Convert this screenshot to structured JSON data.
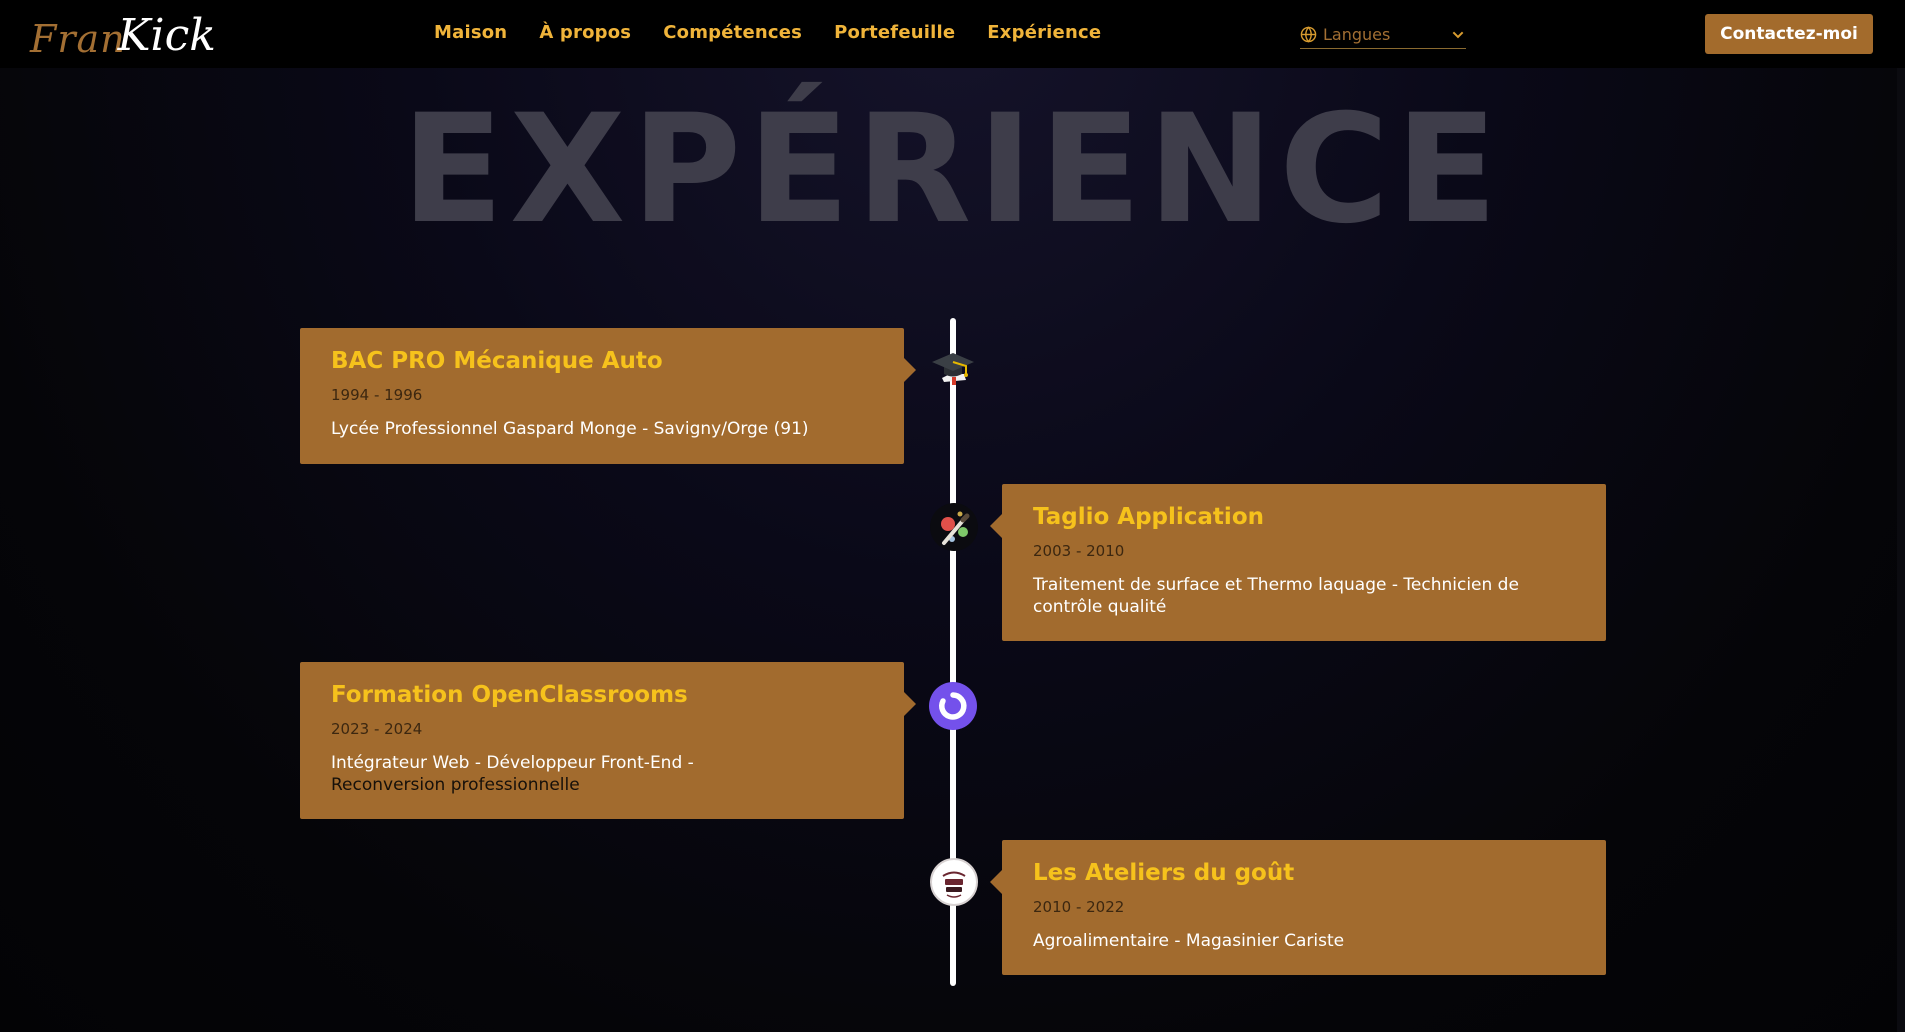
{
  "navbar": {
    "logo": {
      "part1": "Fran",
      "part2": "Kick"
    },
    "links": [
      "Maison",
      "À propos",
      "Compétences",
      "Portefeuille",
      "Expérience"
    ],
    "language": {
      "label": "Langues",
      "icon": "globe-icon"
    },
    "contact_label": "Contactez-moi"
  },
  "section": {
    "title": "EXPÉRIENCE"
  },
  "timeline": [
    {
      "side": "left",
      "icon": "graduation-cap-icon",
      "title": "BAC PRO Mécanique Auto",
      "date": "1994 - 1996",
      "description": "Lycée Professionnel Gaspard Monge - Savigny/Orge (91)"
    },
    {
      "side": "right",
      "icon": "paint-spray-icon",
      "title": "Taglio Application",
      "date": "2003 - 2010",
      "description": "Traitement de surface et Thermo laquage - Technicien de contrôle qualité"
    },
    {
      "side": "left",
      "icon": "openclassrooms-logo-icon",
      "title": "Formation OpenClassrooms",
      "date": "2023 - 2024",
      "description_line1": "Intégrateur Web - Développeur Front-End -",
      "description_line2": "Reconversion professionnelle"
    },
    {
      "side": "right",
      "icon": "ateliers-du-gout-logo-icon",
      "title": "Les Ateliers du goût",
      "date": "2010 - 2022",
      "description": "Agroalimentaire - Magasinier Cariste"
    }
  ],
  "colors": {
    "accent": "#f0b43a",
    "card_bg": "#a26b2e",
    "card_title": "#f6c21c",
    "button_bg": "#a36b2c",
    "title_ghost": "#3e3d4a",
    "openclassrooms": "#7451eb"
  }
}
